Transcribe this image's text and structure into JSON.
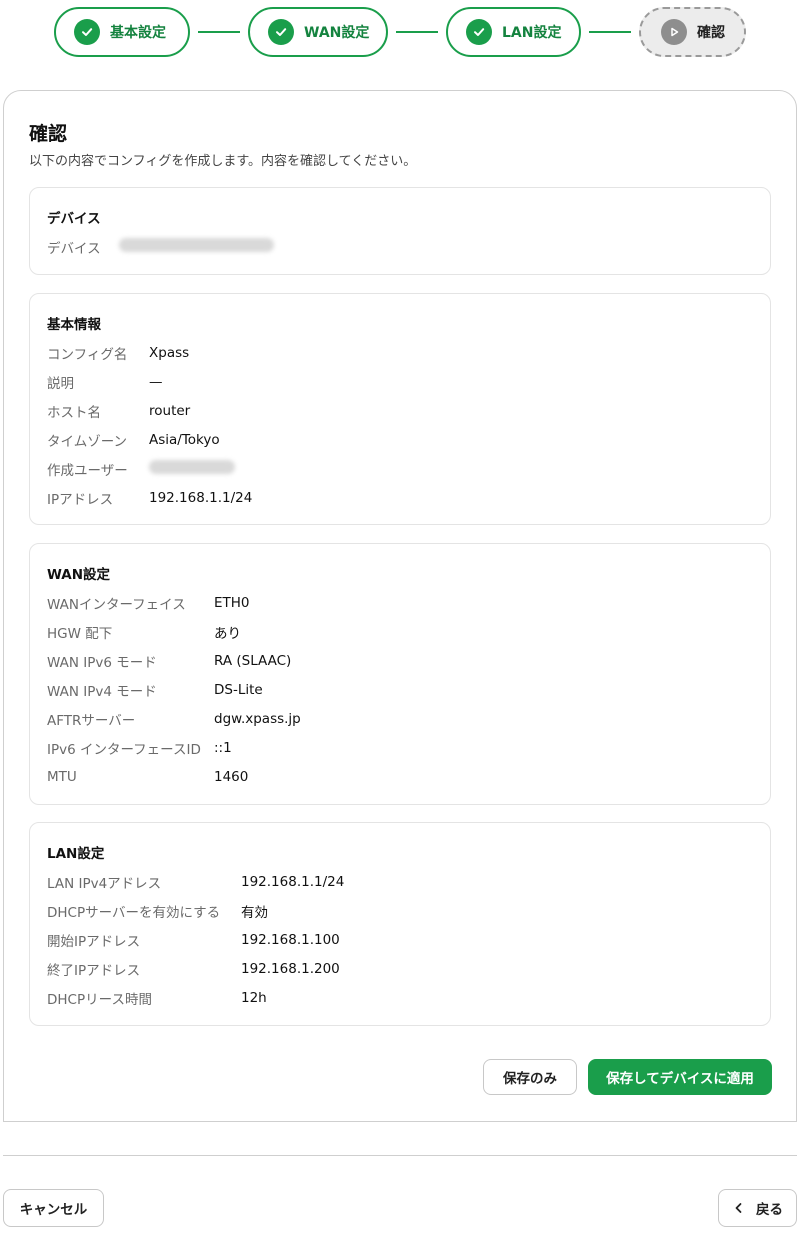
{
  "stepper": {
    "steps": [
      {
        "label": "基本設定",
        "state": "done"
      },
      {
        "label": "WAN設定",
        "state": "done"
      },
      {
        "label": "LAN設定",
        "state": "done"
      },
      {
        "label": "確認",
        "state": "current"
      }
    ]
  },
  "page": {
    "title": "確認",
    "subtitle": "以下の内容でコンフィグを作成します。内容を確認してください。"
  },
  "device": {
    "title": "デバイス",
    "label": "デバイス",
    "value_redacted": true
  },
  "basic": {
    "title": "基本情報",
    "rows": [
      {
        "label": "コンフィグ名",
        "value": "Xpass"
      },
      {
        "label": "説明",
        "value": "—"
      },
      {
        "label": "ホスト名",
        "value": "router"
      },
      {
        "label": "タイムゾーン",
        "value": "Asia/Tokyo"
      },
      {
        "label": "作成ユーザー",
        "value": ""
      },
      {
        "label": "IPアドレス",
        "value": "192.168.1.1/24"
      }
    ]
  },
  "wan": {
    "title": "WAN設定",
    "rows": [
      {
        "label": "WANインターフェイス",
        "value": "ETH0"
      },
      {
        "label": "HGW 配下",
        "value": "あり"
      },
      {
        "label": "WAN IPv6 モード",
        "value": "RA (SLAAC)"
      },
      {
        "label": "WAN IPv4 モード",
        "value": "DS-Lite"
      },
      {
        "label": "AFTRサーバー",
        "value": "dgw.xpass.jp"
      },
      {
        "label": "IPv6 インターフェースID",
        "value": "::1"
      },
      {
        "label": "MTU",
        "value": "1460"
      }
    ]
  },
  "lan": {
    "title": "LAN設定",
    "rows": [
      {
        "label": "LAN IPv4アドレス",
        "value": "192.168.1.1/24"
      },
      {
        "label": "DHCPサーバーを有効にする",
        "value": "有効"
      },
      {
        "label": "開始IPアドレス",
        "value": "192.168.1.100"
      },
      {
        "label": "終了IPアドレス",
        "value": "192.168.1.200"
      },
      {
        "label": "DHCPリース時間",
        "value": "12h"
      }
    ]
  },
  "actions": {
    "save_only": "保存のみ",
    "save_apply": "保存してデバイスに適用"
  },
  "footer": {
    "cancel": "キャンセル",
    "back": "戻る"
  },
  "colors": {
    "accent": "#1a9e4b",
    "border": "#cfcfcf"
  }
}
